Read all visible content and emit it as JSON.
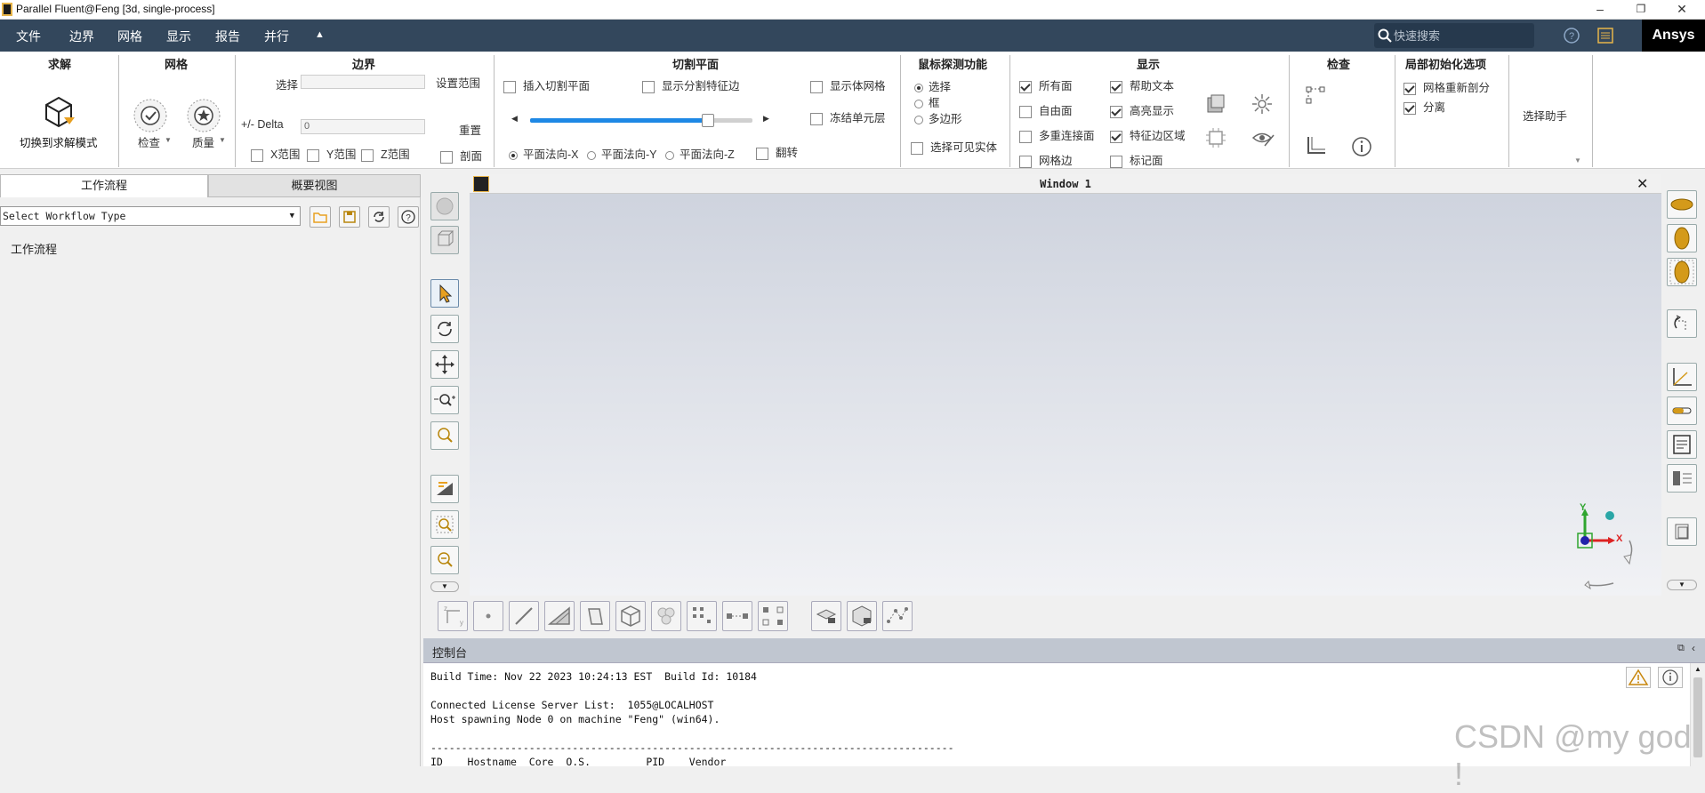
{
  "titlebar": {
    "title": "Parallel Fluent@Feng  [3d, single-process]",
    "minimize": "–",
    "restore": "❐",
    "close": "✕"
  },
  "menubar": {
    "items": [
      "文件",
      "边界",
      "网格",
      "显示",
      "报告",
      "并行"
    ],
    "collapse": "▲",
    "search_placeholder": "快速搜索",
    "logo": "Ansys"
  },
  "ribbon": {
    "solve": {
      "title": "求解",
      "button": "切换到求解模式"
    },
    "mesh": {
      "title": "网格",
      "check": "检查",
      "quality": "质量"
    },
    "boundary": {
      "title": "边界",
      "select_label": "选择",
      "set_range": "设置范围",
      "delta_label": "+/- Delta",
      "delta_value": "0",
      "reset": "重置",
      "x_range": "X范围",
      "y_range": "Y范围",
      "z_range": "Z范围",
      "section": "剖面"
    },
    "clip": {
      "title": "切割平面",
      "insert": "插入切割平面",
      "show_split": "显示分割特征边",
      "show_mesh": "显示体网格",
      "freeze": "冻结单元层",
      "normal_x": "平面法向-X",
      "normal_y": "平面法向-Y",
      "normal_z": "平面法向-Z",
      "flip": "翻转",
      "slider_fraction": 0.8
    },
    "probe": {
      "title": "鼠标探测功能",
      "select": "选择",
      "box": "框",
      "polygon": "多边形",
      "select_visible": "选择可见实体"
    },
    "display": {
      "title": "显示",
      "all_faces": "所有面",
      "free_faces": "自由面",
      "multi_conn": "多重连接面",
      "mesh_edges": "网格边",
      "help_text": "帮助文本",
      "highlight": "高亮显示",
      "feature_zone": "特征边区域",
      "mark_face": "标记面"
    },
    "check": {
      "title": "检查"
    },
    "local_init": {
      "title": "局部初始化选项",
      "remesh": "网格重新剖分",
      "separate": "分离"
    },
    "select_helper": "选择助手"
  },
  "left_panel": {
    "tabs": [
      "工作流程",
      "概要视图"
    ],
    "workflow_type": "Select Workflow Type",
    "tree_root": "工作流程"
  },
  "viewport": {
    "title": "Window 1",
    "close": "✕",
    "axis_y": "Y",
    "axis_x": "X"
  },
  "console": {
    "title": "控制台",
    "lines": [
      "Build Time: Nov 22 2023 10:24:13 EST  Build Id: 10184",
      "",
      "Connected License Server List:  1055@LOCALHOST",
      "Host spawning Node 0 on machine \"Feng\" (win64).",
      "",
      "-------------------------------------------------------------------------------------",
      "ID    Hostname  Core  O.S.         PID    Vendor"
    ]
  },
  "watermark": "CSDN @my god !",
  "colors": {
    "menubar": "#33475c",
    "accent": "#e8a020",
    "blue": "#1e88e5"
  }
}
